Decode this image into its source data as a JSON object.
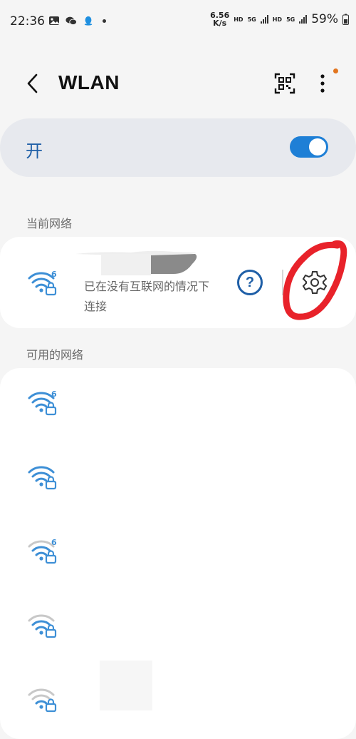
{
  "status_bar": {
    "time": "22:36",
    "left_icons": [
      "image-icon",
      "wechat-icon",
      "qq-icon",
      "dot-icon"
    ],
    "speed_value": "6.56",
    "speed_unit": "K/s",
    "sim1_hd": "HD",
    "sim1_net": "5G",
    "sim2_hd": "HD",
    "sim2_net": "5G",
    "battery": "59%"
  },
  "header": {
    "title": "WLAN",
    "back_icon": "back-arrow-icon",
    "qr_icon": "qr-code-icon",
    "more_icon": "more-vertical-icon",
    "badge_color": "#e2751f"
  },
  "wlan_toggle": {
    "label": "开",
    "state": "on",
    "accent": "#1e7fd6"
  },
  "current_network": {
    "section_label": "当前网络",
    "status": "已在没有互联网的情况下连接",
    "wifi_icon": "wifi-6-lock-icon",
    "help_icon": "help-circle-icon",
    "settings_icon": "gear-icon",
    "annotation_color": "#e8222a"
  },
  "available_networks": {
    "section_label": "可用的网络",
    "items": [
      {
        "icon": "wifi-6-lock-icon",
        "strength": "full"
      },
      {
        "icon": "wifi-lock-icon",
        "strength": "full"
      },
      {
        "icon": "wifi-6-lock-icon",
        "strength": "medium"
      },
      {
        "icon": "wifi-lock-icon",
        "strength": "medium"
      },
      {
        "icon": "wifi-lock-icon",
        "strength": "low"
      }
    ]
  }
}
